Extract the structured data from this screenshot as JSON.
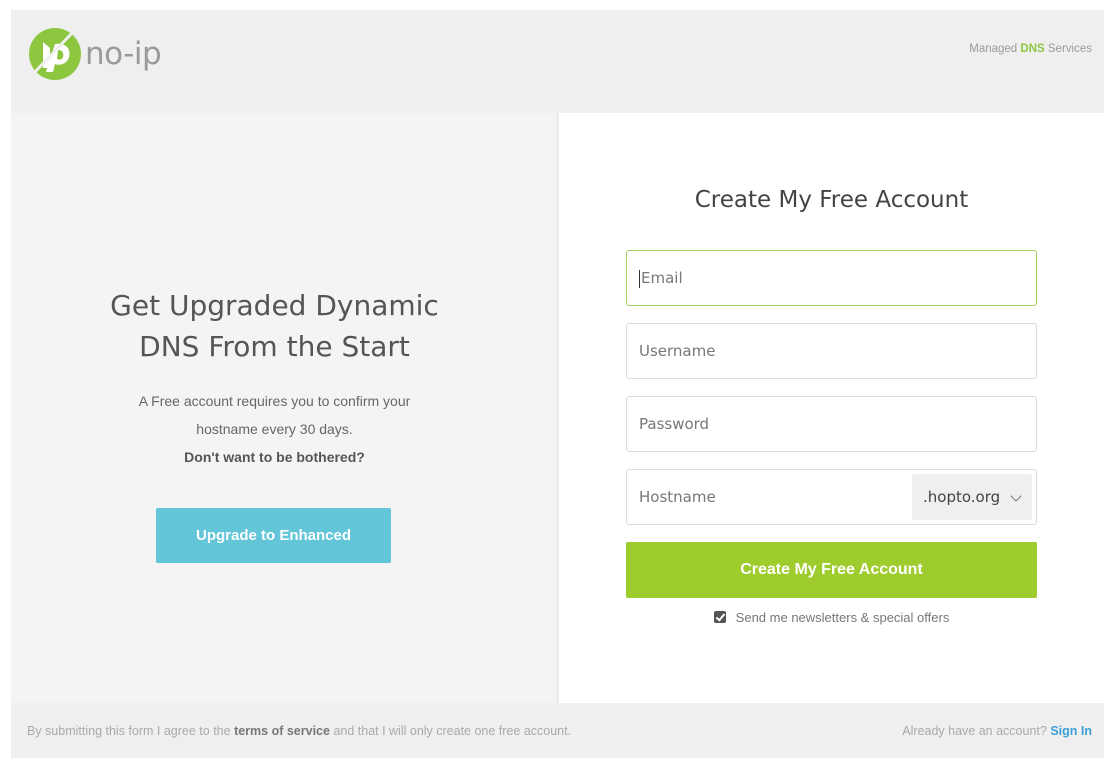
{
  "header": {
    "logo_text": "no-ip",
    "tagline_prefix": "Managed",
    "tagline_accent": "DNS",
    "tagline_suffix": "Services"
  },
  "left": {
    "title_line1": "Get Upgraded Dynamic",
    "title_line2": "DNS From the Start",
    "text_line1": "A Free account requires you to confirm your",
    "text_line2": "hostname every 30 days.",
    "text_bold": "Don't want to be bothered?",
    "upgrade_label": "Upgrade to Enhanced"
  },
  "form": {
    "title": "Create My Free Account",
    "email_placeholder": "Email",
    "username_placeholder": "Username",
    "password_placeholder": "Password",
    "hostname_placeholder": "Hostname",
    "domain_selected": ".hopto.org",
    "submit_label": "Create My Free Account",
    "newsletter_label": "Send me newsletters & special offers",
    "newsletter_checked": true
  },
  "footer": {
    "agree_prefix": "By submitting this form I agree to the",
    "tos_link": "terms of service",
    "agree_suffix": "and that I will only create one free account.",
    "signin_prompt": "Already have an account?",
    "signin_link": "Sign In"
  },
  "colors": {
    "brand_green": "#8dc63f",
    "submit_green": "#9ecc2d",
    "upgrade_blue": "#62c5d8",
    "link_blue": "#3b9ed6"
  }
}
